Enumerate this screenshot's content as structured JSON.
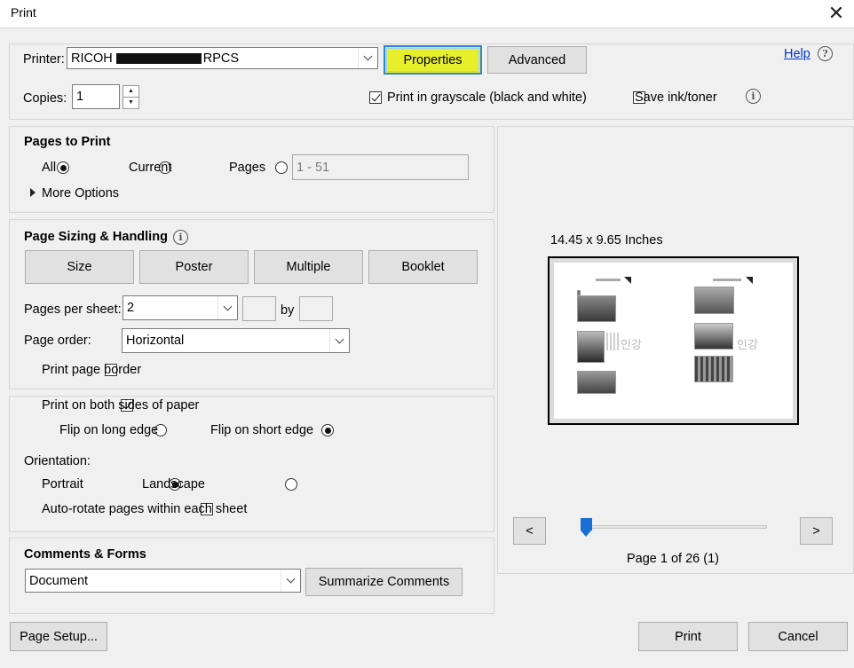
{
  "window": {
    "title": "Print",
    "close_glyph": "✕"
  },
  "printer": {
    "label": "Printer:",
    "name_prefix": "RICOH",
    "name_suffix": "RPCS",
    "properties_label": "Properties",
    "advanced_label": "Advanced",
    "help_label": "Help"
  },
  "copies": {
    "label": "Copies:",
    "value": "1"
  },
  "options": {
    "grayscale_label": "Print in grayscale (black and white)",
    "grayscale_checked": true,
    "save_ink_label": "Save ink/toner",
    "save_ink_checked": false
  },
  "pages_to_print": {
    "heading": "Pages to Print",
    "all_label": "All",
    "current_label": "Current",
    "pages_label": "Pages",
    "pages_range": "1 - 51",
    "more_options_label": "More Options"
  },
  "sizing": {
    "heading": "Page Sizing & Handling",
    "tabs": [
      "Size",
      "Poster",
      "Multiple",
      "Booklet"
    ],
    "pages_per_sheet_label": "Pages per sheet:",
    "pages_per_sheet_value": "2",
    "by_label": "by",
    "page_order_label": "Page order:",
    "page_order_value": "Horizontal",
    "print_border_label": "Print page border"
  },
  "duplex": {
    "both_sides_label": "Print on both sides of paper",
    "long_edge_label": "Flip on long edge",
    "short_edge_label": "Flip on short edge",
    "orientation_label": "Orientation:",
    "portrait_label": "Portrait",
    "landscape_label": "Landscape",
    "auto_rotate_label": "Auto-rotate pages within each sheet"
  },
  "comments": {
    "heading": "Comments & Forms",
    "value": "Document",
    "summarize_label": "Summarize Comments"
  },
  "preview": {
    "dimensions": "14.45 x 9.65 Inches",
    "watermark_left": "인강",
    "watermark_right": "인강",
    "prev_label": "<",
    "next_label": ">",
    "page_status": "Page 1 of 26 (1)",
    "slider_fraction": 0
  },
  "footer": {
    "page_setup_label": "Page Setup...",
    "print_label": "Print",
    "cancel_label": "Cancel"
  }
}
